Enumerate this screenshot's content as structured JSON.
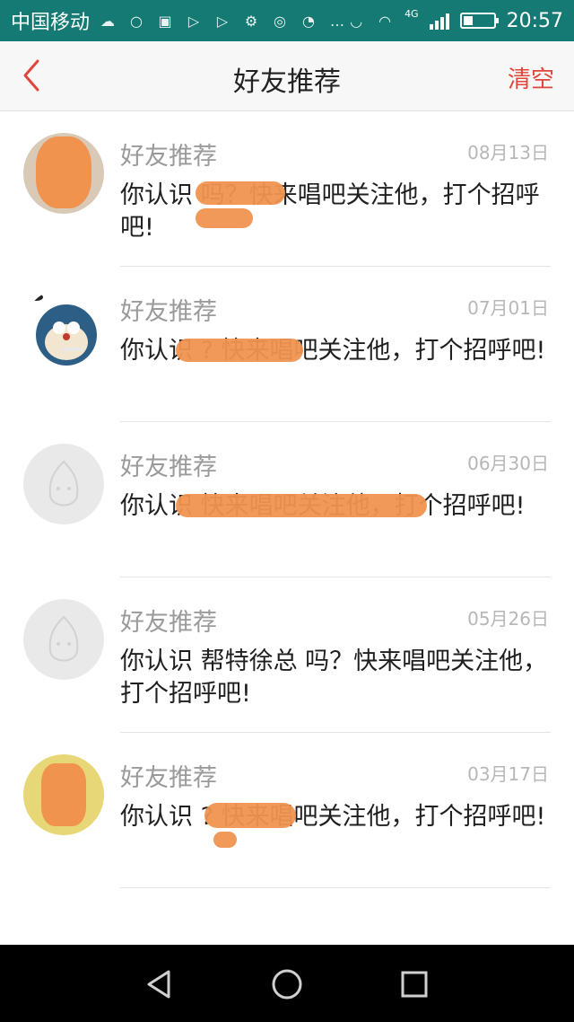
{
  "status_bar": {
    "carrier": "中国移动",
    "network": "4G",
    "time": "20:57",
    "icons": [
      "weather-icon",
      "chat-icon",
      "app-icon",
      "play-icon",
      "play-icon",
      "settings-icon",
      "wechat-icon",
      "hotspot-icon",
      "more-icon",
      "headphone-icon",
      "wifi-icon",
      "signal-icon",
      "battery-icon"
    ]
  },
  "nav": {
    "title": "好友推荐",
    "clear_label": "清空",
    "accent": "#e0453a"
  },
  "items": [
    {
      "title": "好友推荐",
      "date": "08月13日",
      "message": "你认识 吗？快来唱吧关注他，打个招呼吧!"
    },
    {
      "title": "好友推荐",
      "date": "07月01日",
      "message": "你认识 ? 快来唱吧关注他，打个招呼吧!"
    },
    {
      "title": "好友推荐",
      "date": "06月30日",
      "message": "你认识 快来唱吧关注他，打个招呼吧!"
    },
    {
      "title": "好友推荐",
      "date": "05月26日",
      "message": "你认识 帮特徐总 吗？快来唱吧关注他，打个招呼吧!"
    },
    {
      "title": "好友推荐",
      "date": "03月17日",
      "message": "你认识 ? 快来唱吧关注他，打个招呼吧!"
    }
  ]
}
